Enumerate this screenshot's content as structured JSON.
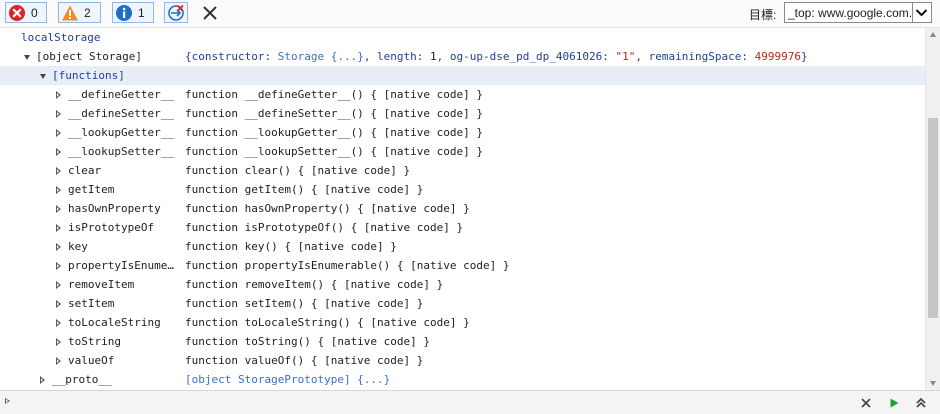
{
  "toolbar": {
    "errors": "0",
    "warnings": "2",
    "info": "1",
    "target_label": "目標:",
    "target_value": "_top: www.google.com.tw"
  },
  "console": {
    "root_label": "localStorage",
    "object": {
      "name": "[object Storage]",
      "summary_open": "{",
      "constructor_key": "constructor: ",
      "constructor_val": "Storage {...}",
      "length_key": ", length: ",
      "length_val": "1",
      "item_key": ", og-up-dse_pd_dp_4061026: ",
      "item_val": "\"1\"",
      "remaining_key": ", remainingSpace: ",
      "remaining_val": "4999976",
      "summary_close": "}"
    },
    "functions_group": "[functions]",
    "functions": [
      {
        "name": "__defineGetter__",
        "value": "function __defineGetter__() { [native code] }"
      },
      {
        "name": "__defineSetter__",
        "value": "function __defineSetter__() { [native code] }"
      },
      {
        "name": "__lookupGetter__",
        "value": "function __lookupGetter__() { [native code] }"
      },
      {
        "name": "__lookupSetter__",
        "value": "function __lookupSetter__() { [native code] }"
      },
      {
        "name": "clear",
        "value": "function clear() { [native code] }"
      },
      {
        "name": "getItem",
        "value": "function getItem() { [native code] }"
      },
      {
        "name": "hasOwnProperty",
        "value": "function hasOwnProperty() { [native code] }"
      },
      {
        "name": "isPrototypeOf",
        "value": "function isPrototypeOf() { [native code] }"
      },
      {
        "name": "key",
        "value": "function key() { [native code] }"
      },
      {
        "name": "propertyIsEnume…",
        "value": "function propertyIsEnumerable() { [native code] }"
      },
      {
        "name": "removeItem",
        "value": "function removeItem() { [native code] }"
      },
      {
        "name": "setItem",
        "value": "function setItem() { [native code] }"
      },
      {
        "name": "toLocaleString",
        "value": "function toLocaleString() { [native code] }"
      },
      {
        "name": "toString",
        "value": "function toString() { [native code] }"
      },
      {
        "name": "valueOf",
        "value": "function valueOf() { [native code] }"
      }
    ],
    "proto": {
      "name": "__proto__",
      "value": "[object StoragePrototype] {...}"
    }
  },
  "colors": {
    "error": "#d9262b",
    "warning": "#f28c22",
    "info": "#1f6fc5",
    "link_blue": "#1f3f99",
    "string_red": "#b5281e",
    "run_green": "#1f9e3c"
  },
  "icons": {
    "errors": "error-circle-icon",
    "warnings": "warning-triangle-icon",
    "info": "info-circle-icon",
    "clear_on_navigate": "clear-on-navigate-icon",
    "clear": "close-x-icon",
    "prompt": "prompt-chevron-icon",
    "bottom_clear": "clear-x-icon",
    "run": "run-play-icon",
    "expand": "expand-up-icon"
  }
}
